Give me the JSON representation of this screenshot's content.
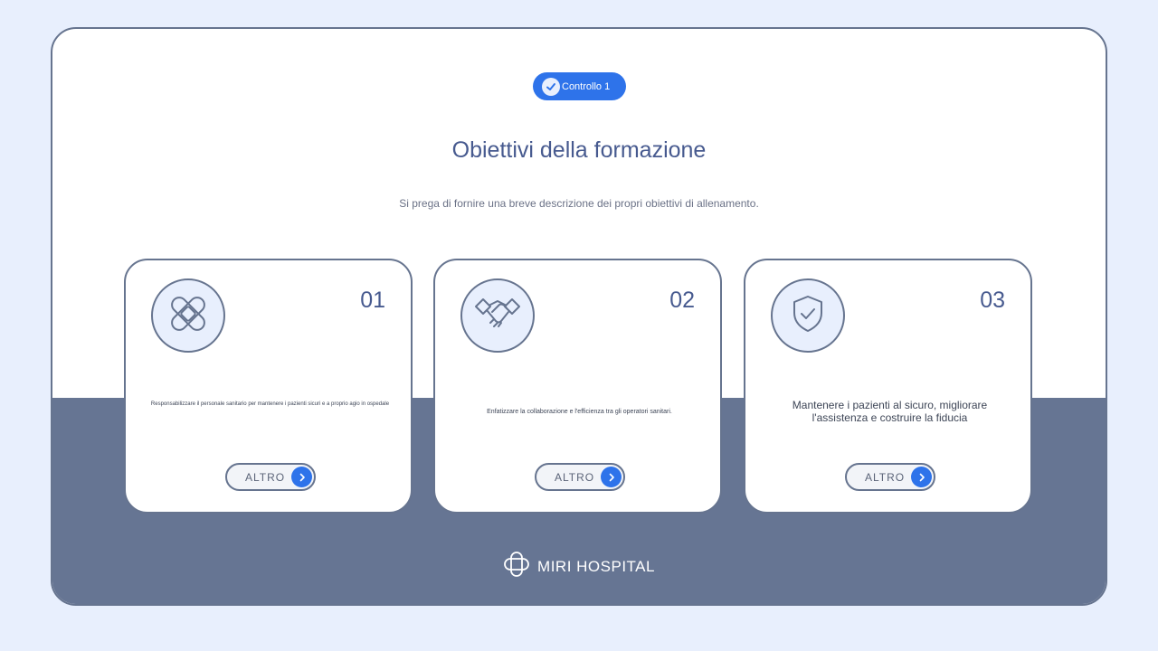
{
  "badge": {
    "label": "Controllo 1",
    "icon": "check-icon"
  },
  "title": "Obiettivi della formazione",
  "subtitle": "Si prega di fornire una breve descrizione dei propri obiettivi di allenamento.",
  "cards": [
    {
      "number": "01",
      "icon": "bandage-icon",
      "description": "Responsabilizzare il personale sanitario per mantenere i pazienti sicuri e a proprio agio in ospedale",
      "button": "ALTRO"
    },
    {
      "number": "02",
      "icon": "handshake-icon",
      "description": "Enfatizzare la collaborazione e l'efficienza tra gli operatori sanitari.",
      "button": "ALTRO"
    },
    {
      "number": "03",
      "icon": "shield-check-icon",
      "description": "Mantenere i pazienti al sicuro, migliorare l'assistenza e costruire la fiducia",
      "button": "ALTRO"
    }
  ],
  "footer": {
    "brand": "MIRI HOSPITAL",
    "logo": "logo-icon"
  },
  "colors": {
    "accent": "#2e73ea",
    "navy": "#475a8f",
    "band": "#667593",
    "background": "#e8effd"
  }
}
